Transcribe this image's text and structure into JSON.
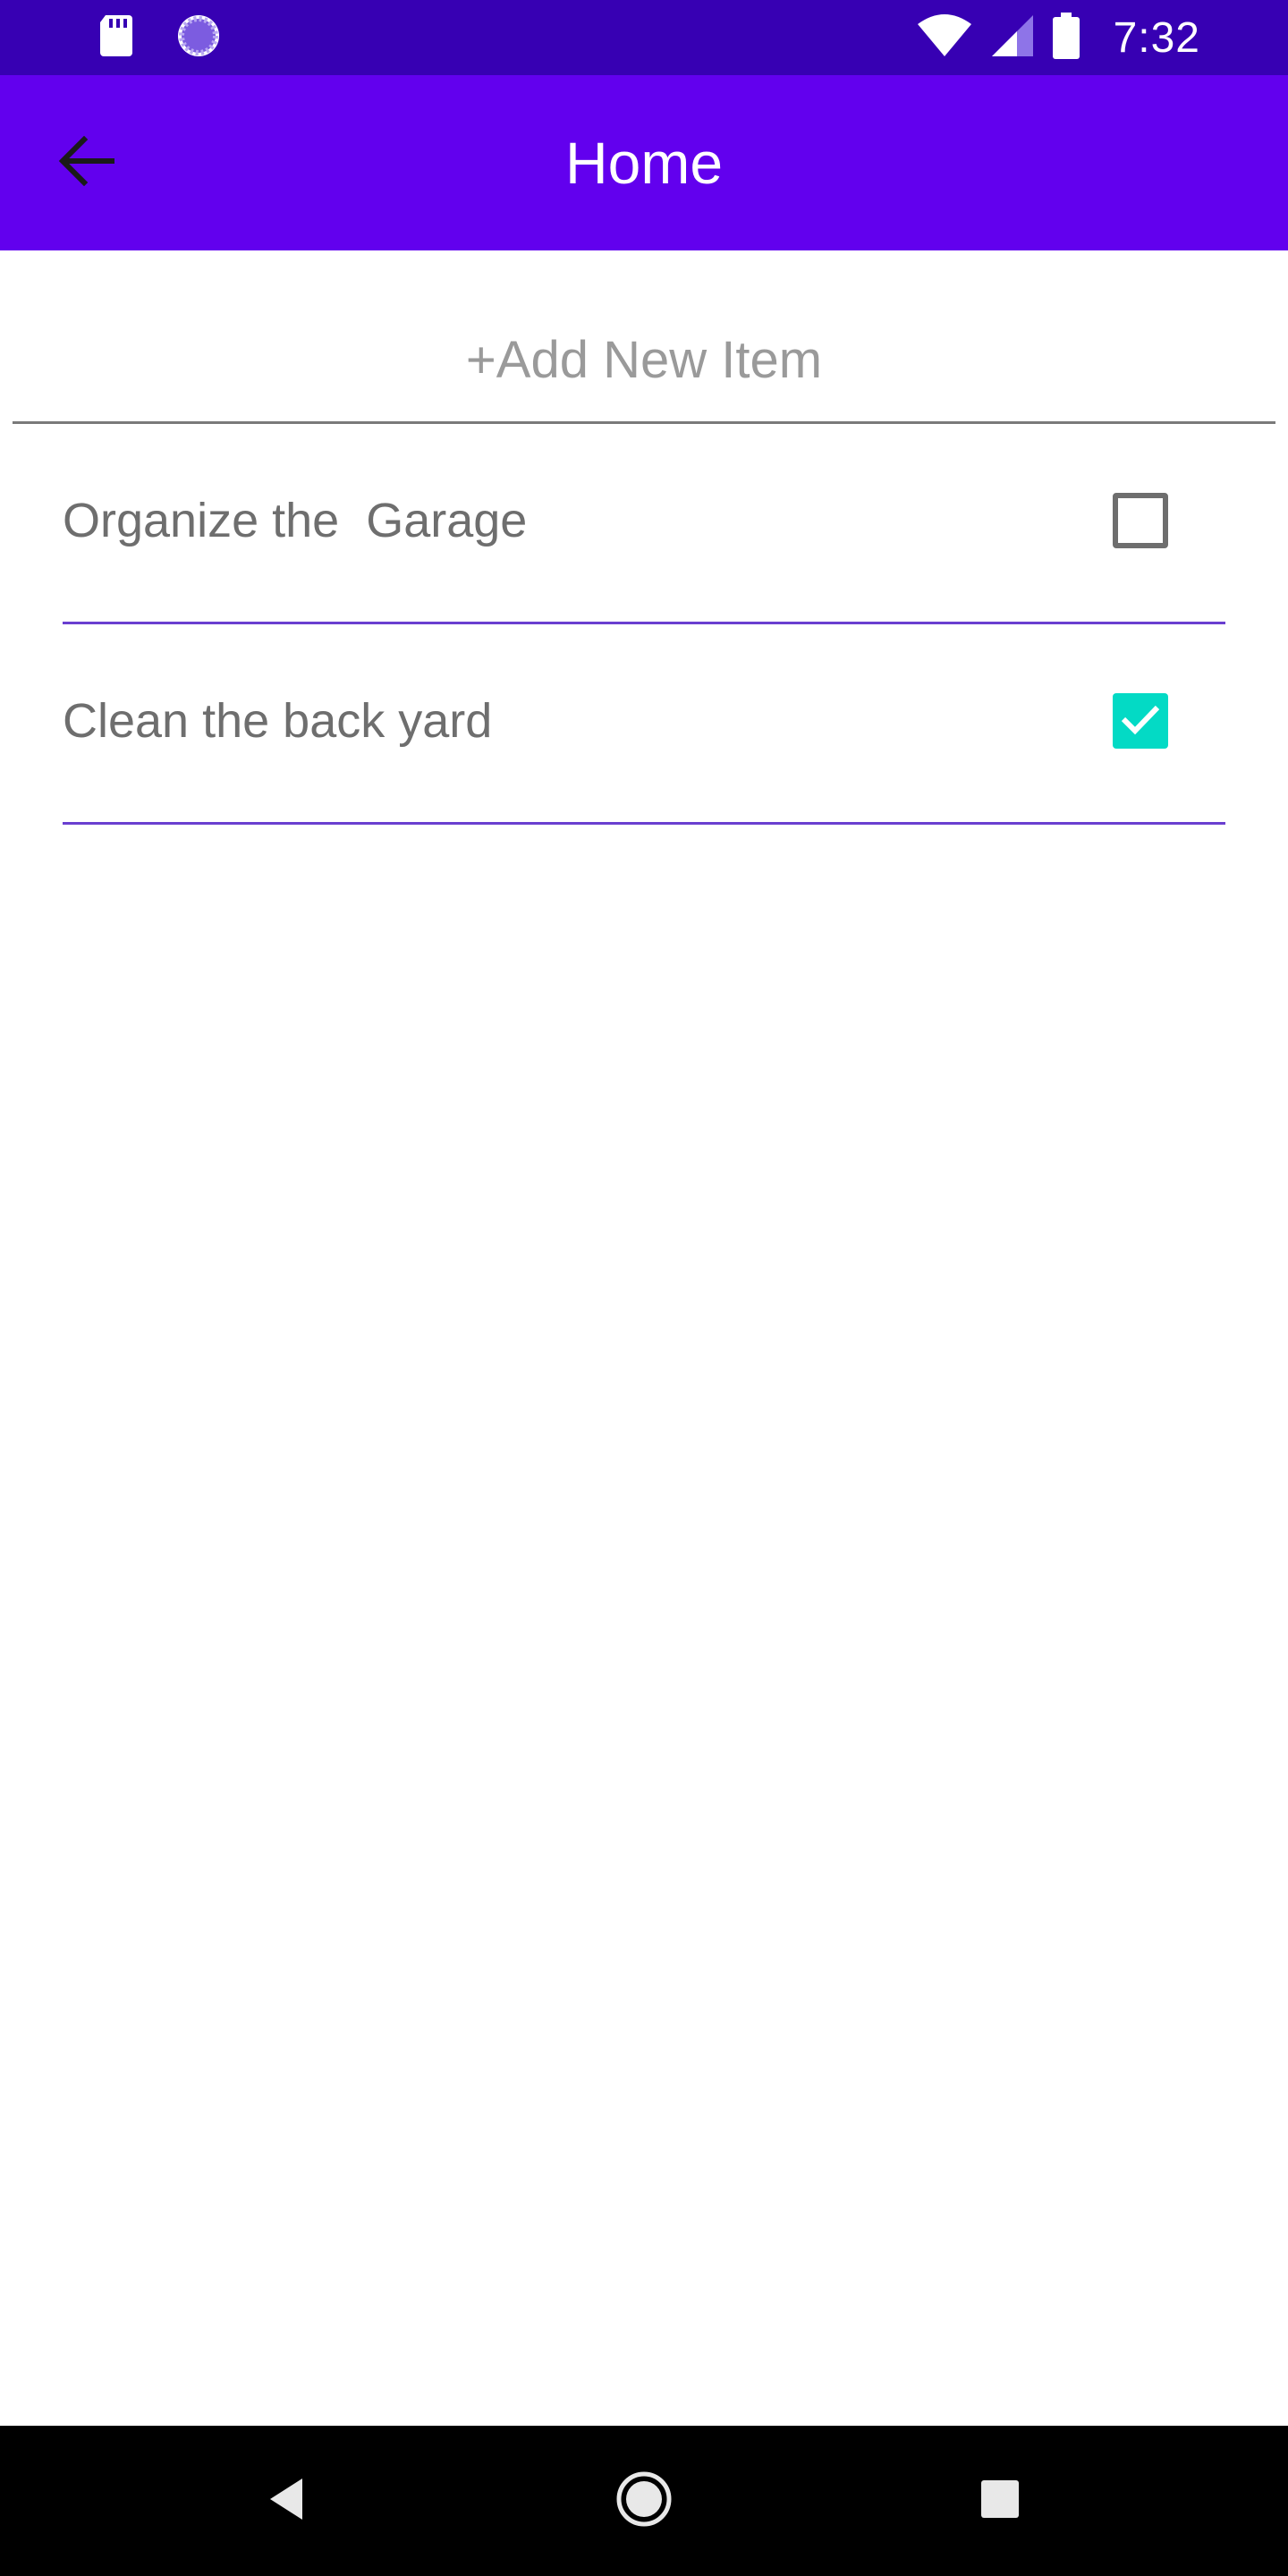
{
  "status_bar": {
    "time": "7:32",
    "left_icons": [
      "sd-card-icon",
      "sync-progress-icon"
    ],
    "right_icons": [
      "wifi-icon",
      "cell-signal-icon",
      "battery-icon"
    ],
    "background": "#3700B3"
  },
  "app_bar": {
    "title": "Home",
    "back_icon": "arrow-back-icon",
    "background": "#6200EE"
  },
  "add_item": {
    "placeholder": "+Add New Item",
    "value": ""
  },
  "todo_items": [
    {
      "label": "Organize the  Garage",
      "checked": false
    },
    {
      "label": "Clean the back yard",
      "checked": true
    }
  ],
  "colors": {
    "accent": "#03DAC5",
    "divider": "#6A3FD0",
    "text": "#6e6e6e"
  },
  "nav_bar": {
    "buttons": [
      "back-triangle-icon",
      "home-circle-icon",
      "recents-square-icon"
    ]
  }
}
